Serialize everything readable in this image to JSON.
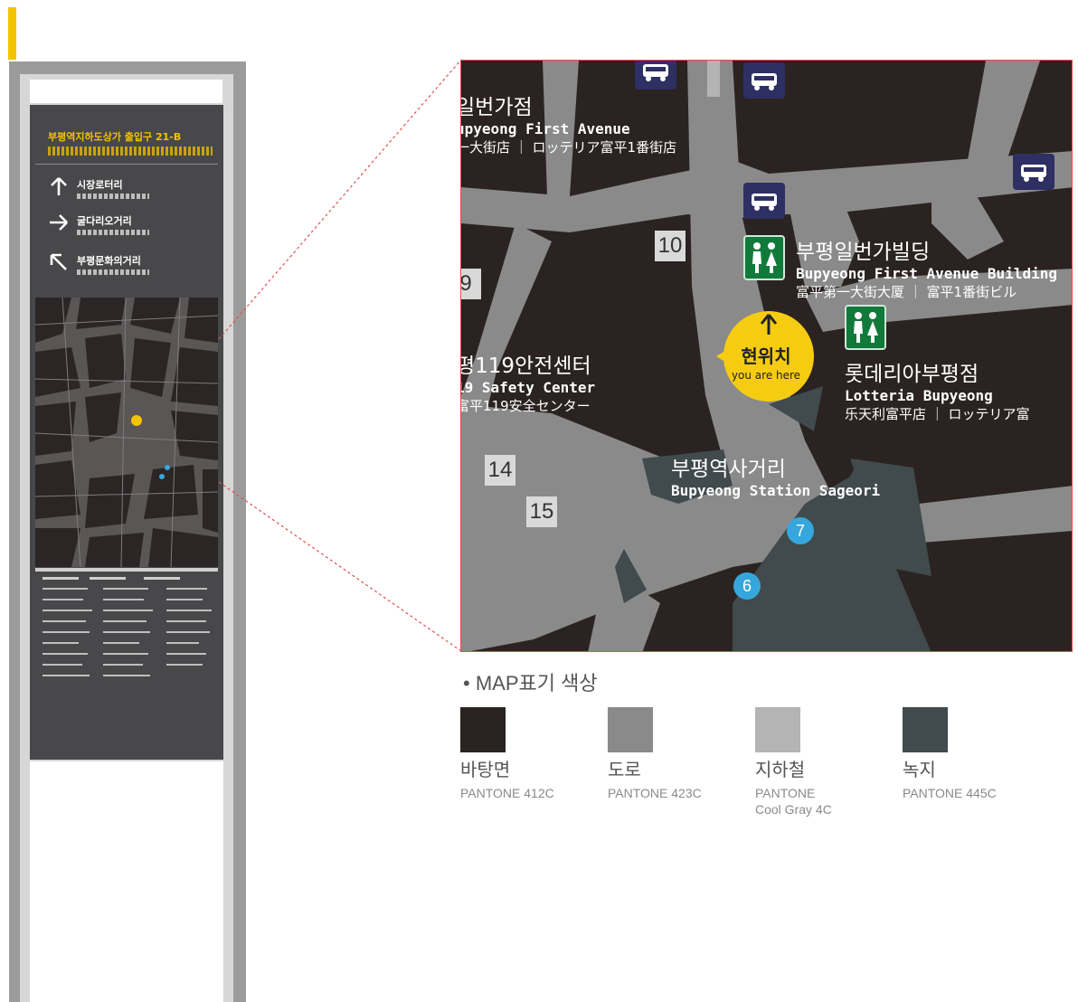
{
  "colors": {
    "accent": "#f3c300",
    "ground": "#2a2321",
    "road": "#8a8a8a",
    "subway": "#b4b4b4",
    "green": "#414a4c",
    "bus": "#2e2f63",
    "restroom": "#117a3a",
    "exit_number": "#35a7dc",
    "you_are_here": "#f6cc12"
  },
  "sign": {
    "title": "부평역지하도상가 출입구 21-B",
    "directions": [
      {
        "arrow": "arrow-up",
        "label": "시장로터리"
      },
      {
        "arrow": "arrow-right",
        "label": "굴다리오거리"
      },
      {
        "arrow": "arrow-up-left",
        "label": "부평문화의거리"
      }
    ]
  },
  "map": {
    "places": [
      {
        "ko": "일번가점",
        "en": "upyeong First Avenue",
        "ja": "一大街店 ｜ ロッテリア富平1番街店"
      },
      {
        "ko": "부평일번가빌딩",
        "en": "Bupyeong First Avenue Building",
        "ja": "富平第一大街大厦 ｜ 富平1番街ビル"
      },
      {
        "ko": "평119안전센터",
        "en": "19 Safety Center",
        "ja": "富平119安全センター"
      },
      {
        "ko": "롯데리아부평점",
        "en": "Lotteria Bupyeong",
        "ja": "乐天利富平店 ｜ ロッテリア富"
      },
      {
        "ko": "부평역사거리",
        "en": "Bupyeong Station Sageori"
      }
    ],
    "block_numbers": [
      "10",
      "9",
      "14",
      "15"
    ],
    "exit_numbers": [
      "7",
      "6"
    ],
    "you_are_here": {
      "ko": "현위치",
      "en": "you are here"
    },
    "icons": [
      "bus-icon",
      "bus-icon",
      "bus-icon",
      "bus-icon",
      "restroom-icon",
      "restroom-icon"
    ]
  },
  "legend": {
    "title": "MAP표기 색상",
    "items": [
      {
        "name": "바탕면",
        "code": "PANTONE 412C",
        "color": "#2a2321"
      },
      {
        "name": "도로",
        "code": "PANTONE 423C",
        "color": "#8a8a8a"
      },
      {
        "name": "지하철",
        "code": "PANTONE\nCool Gray 4C",
        "color": "#b4b4b4"
      },
      {
        "name": "녹지",
        "code": "PANTONE 445C",
        "color": "#414a4c"
      }
    ]
  }
}
